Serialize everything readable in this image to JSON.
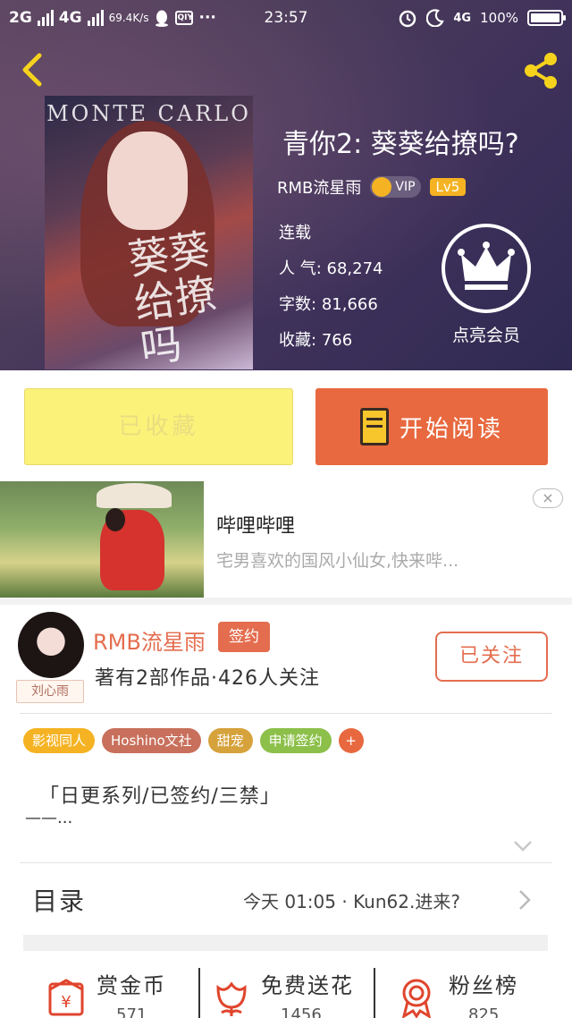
{
  "status_bar": {
    "net1": "2G",
    "net2": "4G",
    "speed": "69.4K/s",
    "app_badge": "QIY",
    "more": "···",
    "time": "23:57",
    "net_lte": "4G",
    "battery": "100%"
  },
  "book": {
    "title": "青你2: 葵葵给撩吗?",
    "author": "RMB流星雨",
    "vip_label": "VIP",
    "level": "Lv5",
    "status": "连载",
    "popularity_label": "人 气:",
    "popularity": "68,274",
    "words_label": "字数:",
    "words": "81,666",
    "favorites_label": "收藏:",
    "favorites": "766",
    "member_label": "点亮会员"
  },
  "cover": {
    "header_text": "MONTE CARLO",
    "calligraphy": "葵葵给撩吗"
  },
  "actions": {
    "favorited_label": "已收藏",
    "read_label": "开始阅读"
  },
  "ad": {
    "title": "哔哩哔哩",
    "description": "宅男喜欢的国风小仙女,快来哔...",
    "close": "×"
  },
  "author": {
    "name": "RMB流星雨",
    "sign_badge": "签约",
    "meta": "著有2部作品·426人关注",
    "follow_label": "已关注",
    "avatar_tag": "刘心雨"
  },
  "tags": [
    {
      "label": "影视同人",
      "color": "#f5b323"
    },
    {
      "label": "Hoshino文社",
      "color": "#c8705c"
    },
    {
      "label": "甜宠",
      "color": "#d6a23c"
    },
    {
      "label": "申请签约",
      "color": "#8cc04a"
    },
    {
      "label": "+",
      "color": "#e8693f"
    }
  ],
  "description": {
    "line1": "「日更系列/已签约/三禁」",
    "line2": "——..."
  },
  "toc": {
    "label": "目录",
    "latest": "今天 01:05 · Kun62.进来?"
  },
  "bottom_stats": [
    {
      "label": "赏金币",
      "value": "571"
    },
    {
      "label": "免费送花",
      "value": "1456"
    },
    {
      "label": "粉丝榜",
      "value": "825"
    }
  ],
  "colors": {
    "accent": "#e8693f",
    "favorited_bg": "#fbf27a",
    "author_red": "#e46d4f"
  }
}
